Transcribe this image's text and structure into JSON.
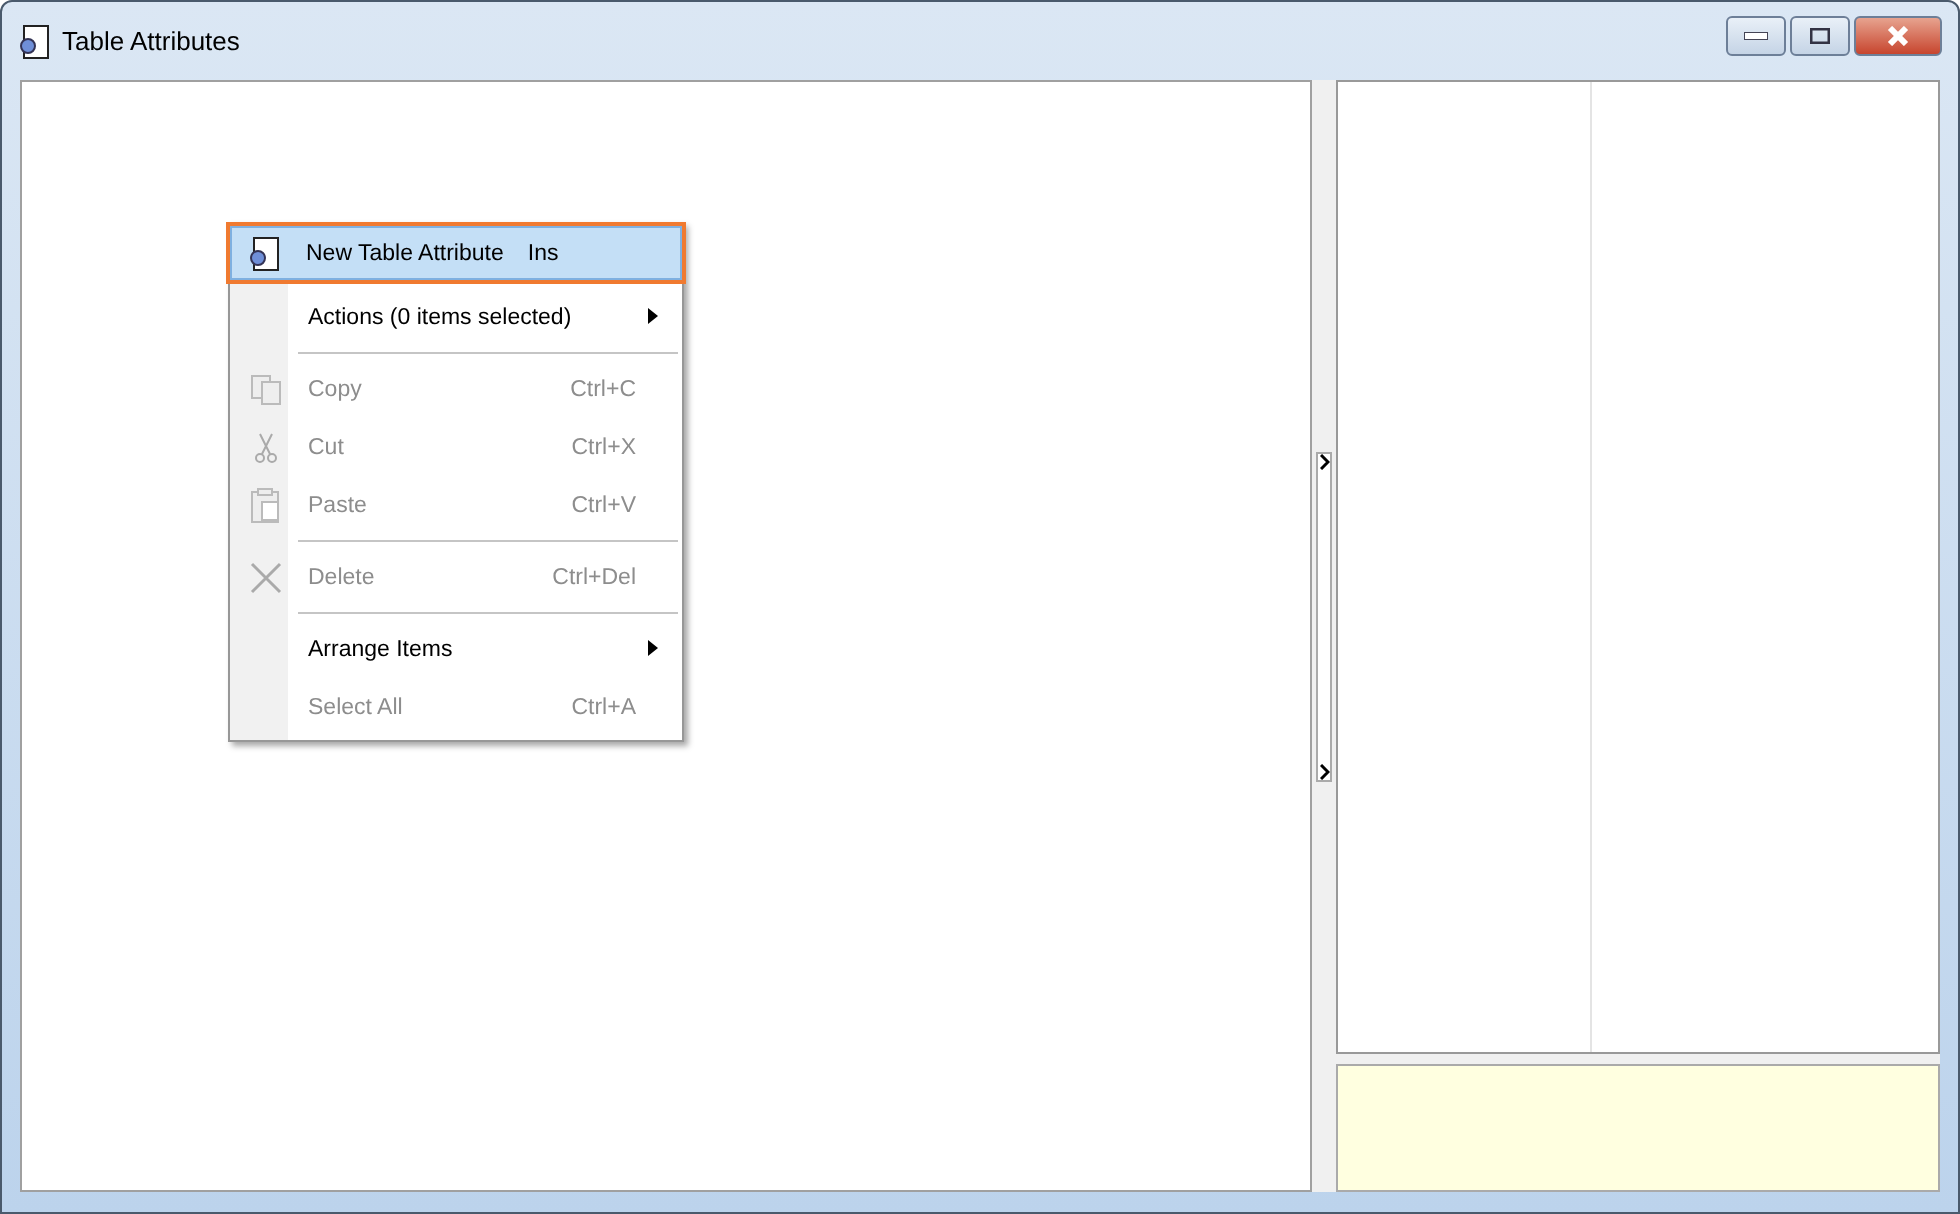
{
  "window": {
    "title": "Table Attributes"
  },
  "context_menu": {
    "items": [
      {
        "kind": "new",
        "label": "New Table Attribute",
        "shortcut": "Ins",
        "selected": true,
        "disabled": false
      },
      {
        "kind": "submenu",
        "label": "Actions (0 items selected)",
        "selected": false,
        "disabled": false
      },
      {
        "kind": "separator"
      },
      {
        "kind": "copy",
        "label": "Copy",
        "shortcut": "Ctrl+C",
        "selected": false,
        "disabled": true
      },
      {
        "kind": "cut",
        "label": "Cut",
        "shortcut": "Ctrl+X",
        "selected": false,
        "disabled": true
      },
      {
        "kind": "paste",
        "label": "Paste",
        "shortcut": "Ctrl+V",
        "selected": false,
        "disabled": true
      },
      {
        "kind": "separator"
      },
      {
        "kind": "delete",
        "label": "Delete",
        "shortcut": "Ctrl+Del",
        "selected": false,
        "disabled": true
      },
      {
        "kind": "separator"
      },
      {
        "kind": "submenu",
        "label": "Arrange Items",
        "selected": false,
        "disabled": false
      },
      {
        "kind": "plain",
        "label": "Select All",
        "shortcut": "Ctrl+A",
        "selected": false,
        "disabled": true
      }
    ]
  }
}
